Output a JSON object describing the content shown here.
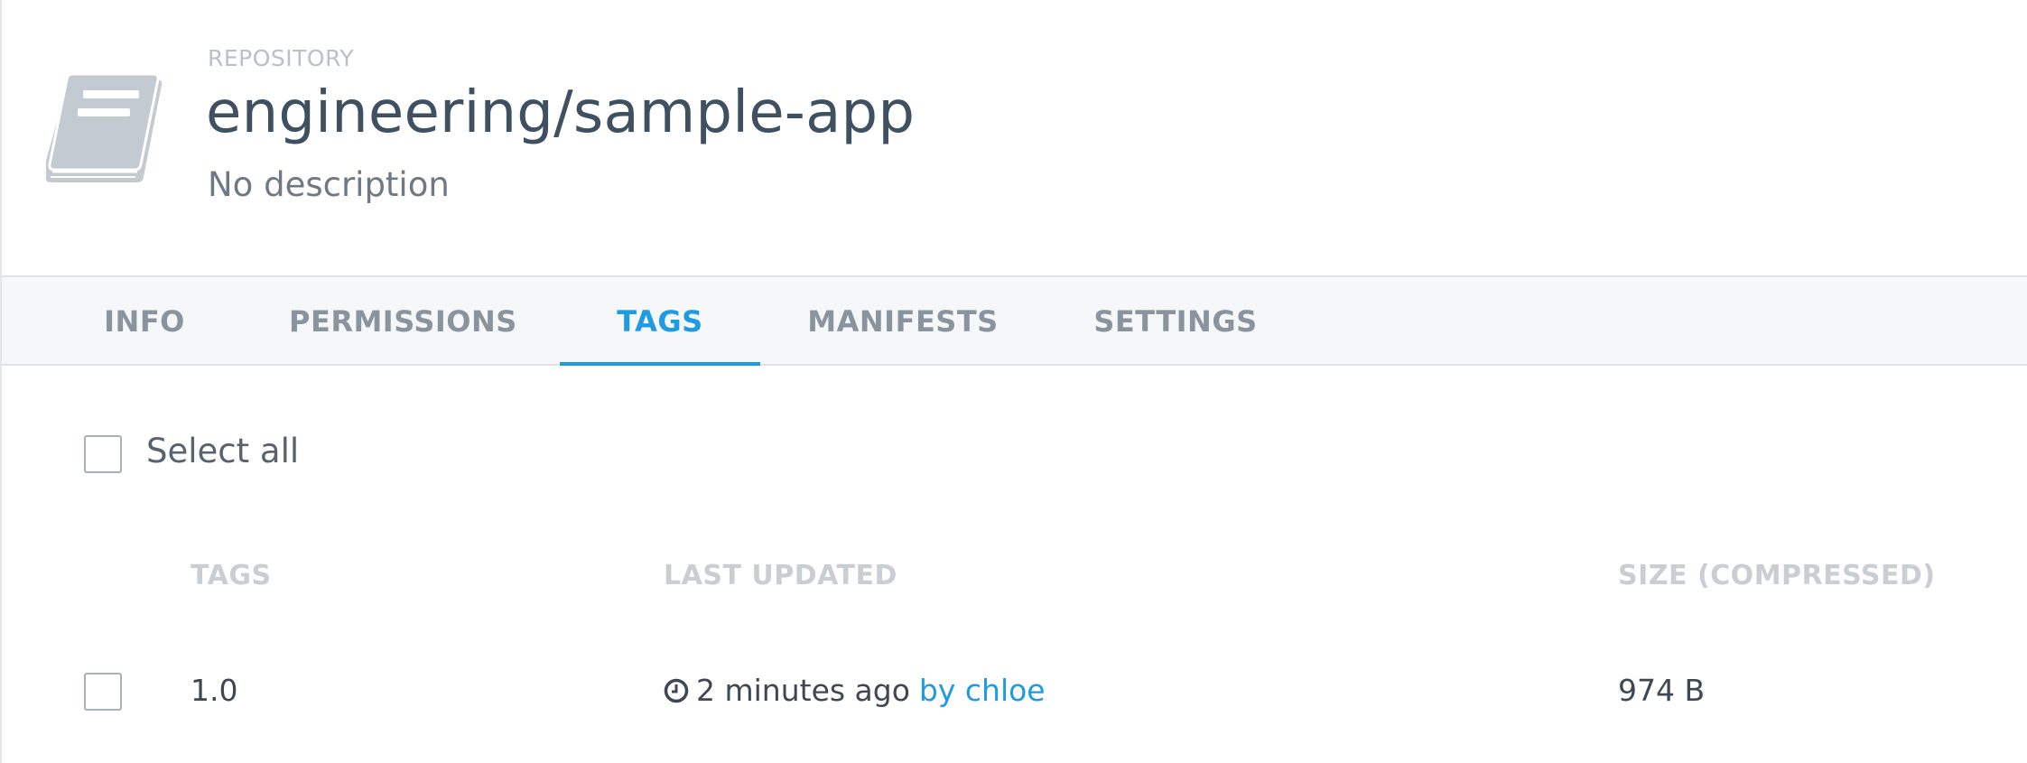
{
  "repository": {
    "kind_label": "REPOSITORY",
    "name": "engineering/sample-app",
    "description": "No description",
    "icon": "book-icon"
  },
  "tabs": [
    {
      "label": "INFO",
      "active": false
    },
    {
      "label": "PERMISSIONS",
      "active": false
    },
    {
      "label": "TAGS",
      "active": true
    },
    {
      "label": "MANIFESTS",
      "active": false
    },
    {
      "label": "SETTINGS",
      "active": false
    }
  ],
  "tag_list": {
    "select_all_label": "Select all",
    "columns": [
      "TAGS",
      "LAST UPDATED",
      "SIZE (COMPRESSED)"
    ],
    "rows": [
      {
        "tag": "1.0",
        "updated": "2 minutes ago",
        "updated_by": "by chloe",
        "size": "974 B"
      }
    ]
  },
  "colors": {
    "accent": "#1e9be3",
    "title": "#3f5061",
    "muted": "#8a949e",
    "icon": "#c3cad1"
  }
}
